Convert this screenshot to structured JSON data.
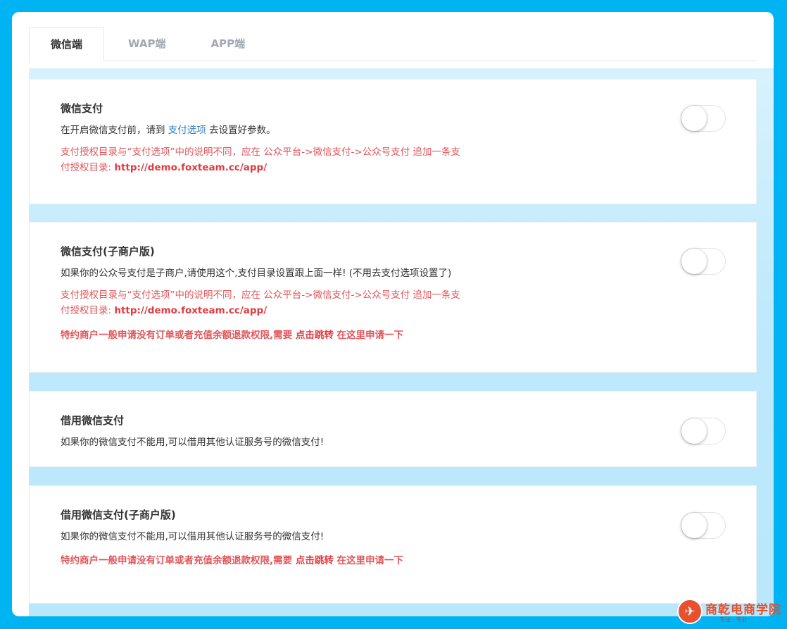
{
  "tabs": [
    {
      "label": "微信端",
      "active": true
    },
    {
      "label": "WAP端",
      "active": false
    },
    {
      "label": "APP端",
      "active": false
    }
  ],
  "cards": {
    "wechat_pay": {
      "title": "微信支付",
      "desc_before": "在开启微信支付前，请到 ",
      "desc_link": "支付选项",
      "desc_after": " 去设置好参数。",
      "warn_line1": "支付授权目录与“支付选项”中的说明不同，应在 公众平台->微信支付->公众号支付 追加一条支",
      "warn_line2_prefix": "付授权目录: ",
      "warn_url": "http://demo.foxteam.cc/app/",
      "enabled": false
    },
    "wechat_pay_sub": {
      "title": "微信支付(子商户版)",
      "desc": "如果你的公众号支付是子商户,请使用这个,支付目录设置跟上面一样! (不用去支付选项设置了)",
      "warn_line1": "支付授权目录与“支付选项”中的说明不同，应在 公众平台->微信支付->公众号支付 追加一条支",
      "warn_line2_prefix": "付授权目录: ",
      "warn_url": "http://demo.foxteam.cc/app/",
      "special_prefix": "特约商户一般申请没有订单或者充值余额退款权限,需要 ",
      "special_link": "点击跳转",
      "special_suffix": " 在这里申请一下",
      "enabled": false
    },
    "borrow_pay": {
      "title": "借用微信支付",
      "desc": "如果你的微信支付不能用,可以借用其他认证服务号的微信支付!",
      "enabled": false
    },
    "borrow_pay_sub": {
      "title": "借用微信支付(子商户版)",
      "desc": "如果你的微信支付不能用,可以借用其他认证服务号的微信支付!",
      "special_prefix": "特约商户一般申请没有订单或者充值余额退款权限,需要 ",
      "special_link": "点击跳转",
      "special_suffix": " 在这里申请一下",
      "enabled": false
    }
  },
  "watermark": {
    "name": "商乾电商学院",
    "sub": "专注 · 专业"
  },
  "colors": {
    "background": "#00b4f4",
    "warning": "#e0565a",
    "link": "#2d7fc6",
    "brand": "#e8502e"
  }
}
